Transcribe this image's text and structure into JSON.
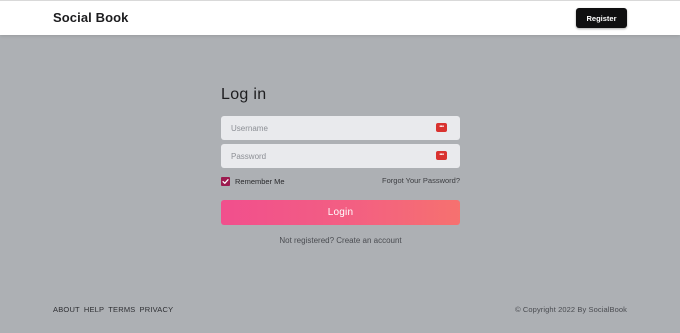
{
  "header": {
    "brand": "Social Book",
    "register_label": "Register"
  },
  "login": {
    "title": "Log in",
    "username_placeholder": "Username",
    "password_placeholder": "Password",
    "field_icon": "password-manager-key-icon",
    "field_icon_text": "•••",
    "remember_label": "Remember Me",
    "remember_checked": true,
    "forgot_label": "Forgot Your Password?",
    "submit_label": "Login",
    "signup_text": "Not registered? Create an account"
  },
  "footer": {
    "links": [
      "ABOUT",
      "HELP",
      "TERMS",
      "PRIVACY"
    ],
    "copyright": "© Copyright 2022 By SocialBook"
  },
  "colors": {
    "background": "#adb0b4",
    "header_bg": "#ffffff",
    "button_dark": "#0f0f10",
    "login_gradient_start": "#f14f8d",
    "login_gradient_end": "#f6716f",
    "checkbox": "#9c1b4f",
    "key_icon": "#d9322f"
  }
}
